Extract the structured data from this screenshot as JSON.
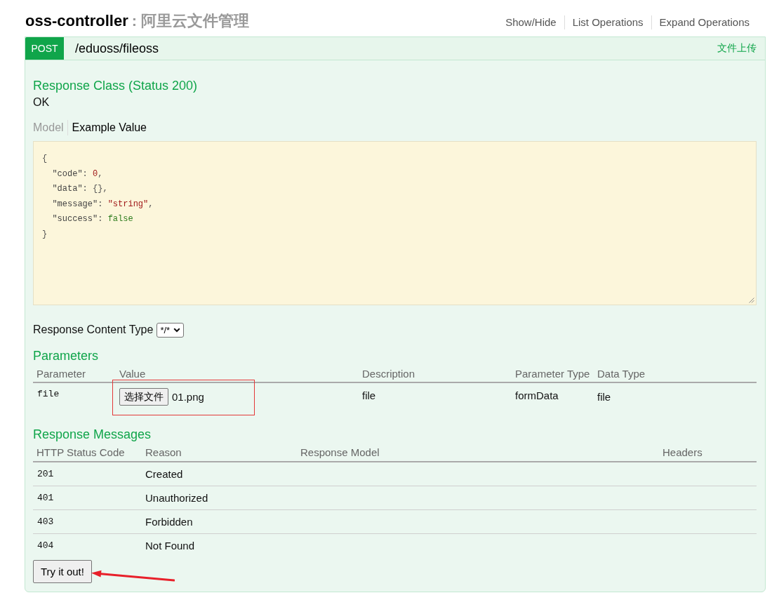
{
  "resource": {
    "name": "oss-controller",
    "description": ": 阿里云文件管理"
  },
  "resource_links": [
    "Show/Hide",
    "List Operations",
    "Expand Operations"
  ],
  "operation": {
    "method": "POST",
    "path": "/eduoss/fileoss",
    "summary": "文件上传",
    "response_class": {
      "title": "Response Class (Status 200)",
      "value": "OK",
      "tabs": [
        {
          "label": "Model",
          "selected": false
        },
        {
          "label": "Example Value",
          "selected": true
        }
      ],
      "example_lines": [
        [
          {
            "kind": "punct",
            "text": "{"
          }
        ],
        [
          {
            "kind": "key",
            "text": "  \"code\""
          },
          {
            "kind": "punct",
            "text": ": "
          },
          {
            "kind": "number",
            "text": "0"
          },
          {
            "kind": "punct",
            "text": ","
          }
        ],
        [
          {
            "kind": "key",
            "text": "  \"data\""
          },
          {
            "kind": "punct",
            "text": ": {},"
          }
        ],
        [
          {
            "kind": "key",
            "text": "  \"message\""
          },
          {
            "kind": "punct",
            "text": ": "
          },
          {
            "kind": "string",
            "text": "\"string\""
          },
          {
            "kind": "punct",
            "text": ","
          }
        ],
        [
          {
            "kind": "key",
            "text": "  \"success\""
          },
          {
            "kind": "punct",
            "text": ": "
          },
          {
            "kind": "boolean",
            "text": "false"
          }
        ],
        [
          {
            "kind": "punct",
            "text": "}"
          }
        ]
      ]
    },
    "content_type": {
      "label": "Response Content Type",
      "value": "*/*"
    },
    "parameters": {
      "title": "Parameters",
      "columns": [
        "Parameter",
        "Value",
        "Description",
        "Parameter Type",
        "Data Type"
      ],
      "rows": [
        {
          "parameter": "file",
          "value": {
            "button": "选择文件",
            "file_name": "01.png",
            "annotated": true
          },
          "description": "file",
          "parameter_type": "formData",
          "data_type": "file"
        }
      ]
    },
    "response_messages": {
      "title": "Response Messages",
      "columns": [
        "HTTP Status Code",
        "Reason",
        "Response Model",
        "Headers"
      ],
      "rows": [
        {
          "code": "201",
          "reason": "Created"
        },
        {
          "code": "401",
          "reason": "Unauthorized"
        },
        {
          "code": "403",
          "reason": "Forbidden"
        },
        {
          "code": "404",
          "reason": "Not Found"
        }
      ]
    },
    "try_button": {
      "label": "Try it out!",
      "annotated": true
    }
  }
}
